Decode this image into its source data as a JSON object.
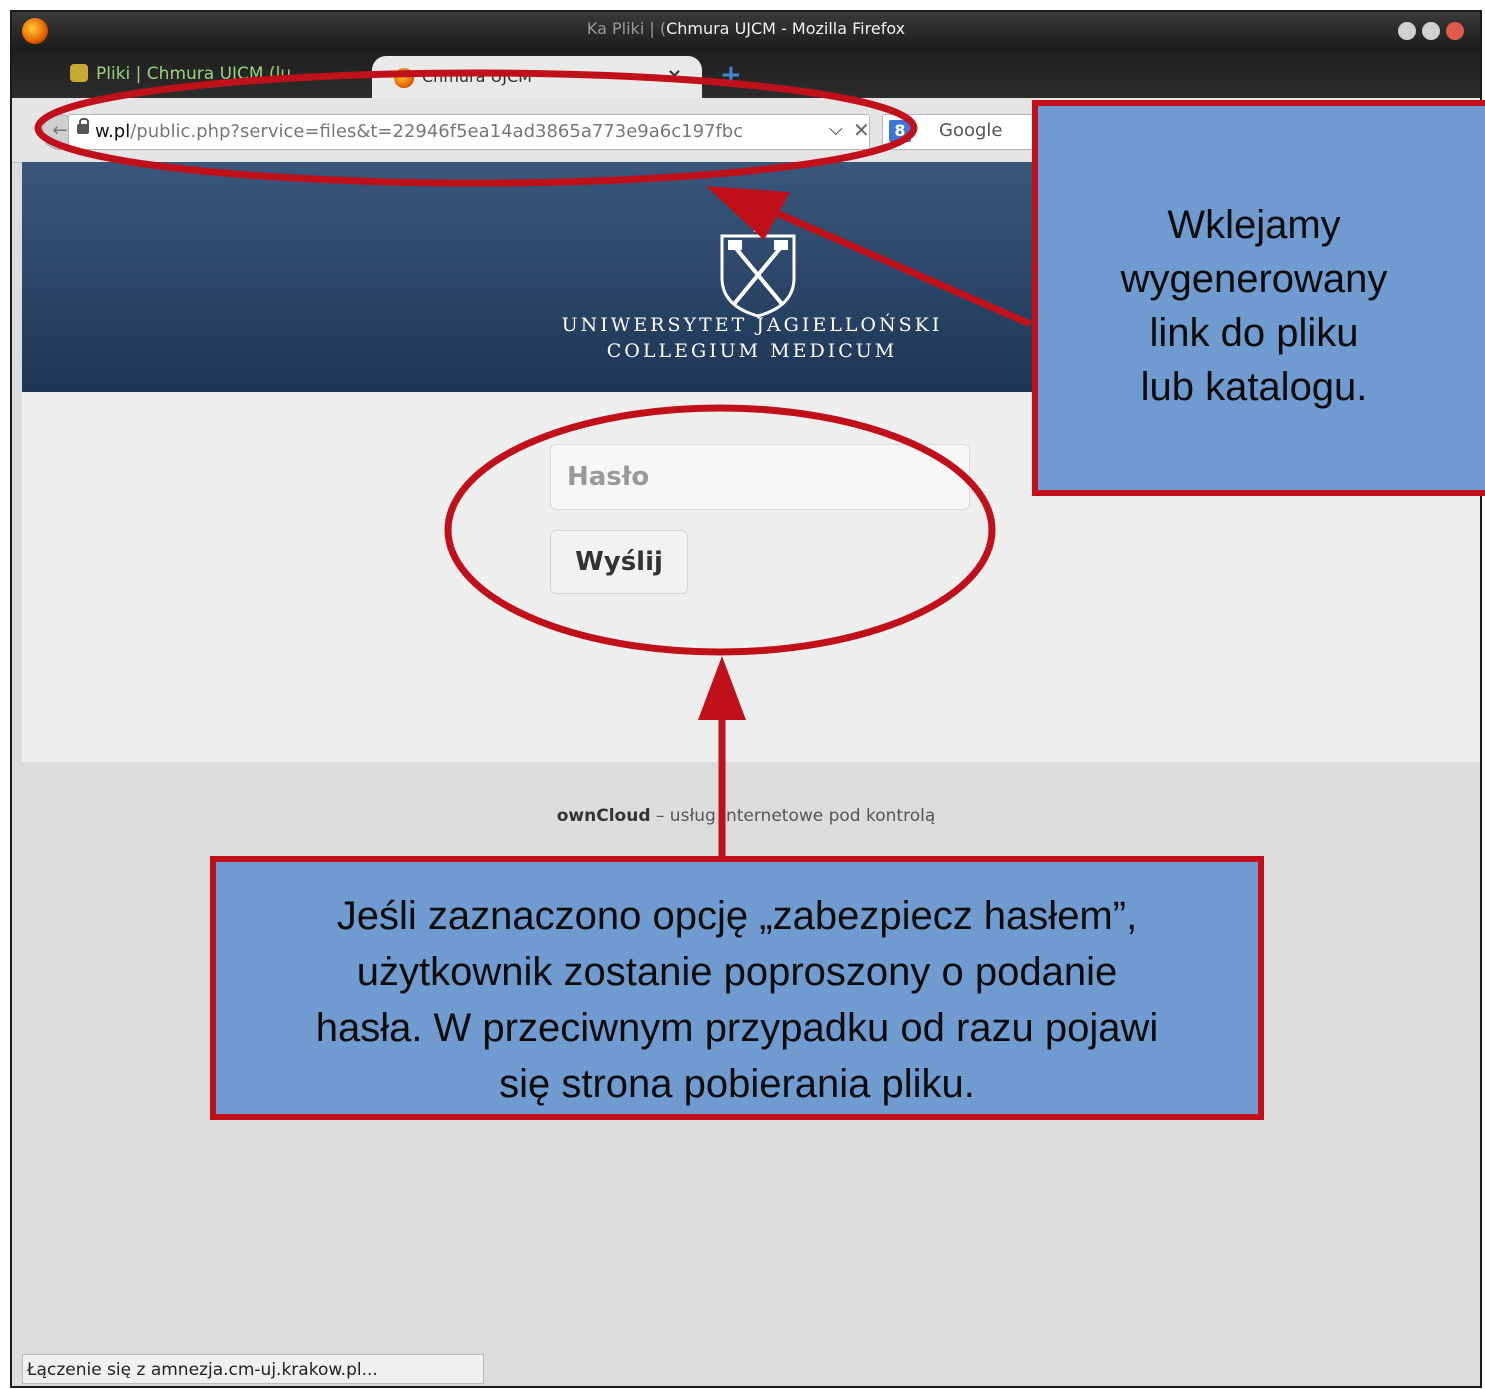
{
  "window": {
    "title_dim": "Ka Pliki | (",
    "title": "Chmura UJCM - Mozilla Firefox"
  },
  "tabs": [
    {
      "label": "Pliki | Chmura UJCM (lu..."
    },
    {
      "label": "Chmura UJCM",
      "close": "×"
    }
  ],
  "newtab_symbol": "+",
  "navbar": {
    "url_host": "w.pl",
    "url_path": "/public.php?service=files&t=22946f5ea14ad3865a773e9a6c197fbc",
    "search_engine_letter": "8",
    "search_placeholder": "Google"
  },
  "banner": {
    "line1": "UNIWERSYTET JAGIELLOŃSKI",
    "line2": "COLLEGIUM MEDICUM"
  },
  "form": {
    "password_placeholder": "Hasło",
    "submit_label": "Wyślij"
  },
  "footer": {
    "brand": "ownCloud",
    "text": " – usług internetowe pod kontrolą"
  },
  "status_bar": "Łączenie się z amnezja.cm-uj.krakow.pl...",
  "callouts": {
    "top": [
      "Wklejamy",
      "wygenerowany",
      "link do pliku",
      "lub katalogu."
    ],
    "bottom": [
      "Jeśli zaznaczono opcję „zabezpiecz hasłem”,",
      "użytkownik zostanie poproszony o podanie",
      "hasła. W przeciwnym przypadku od razu pojawi",
      "się strona pobierania pliku."
    ]
  },
  "colors": {
    "banner": "#2a4569",
    "callout_fill": "#6f9bd1",
    "annotation_red": "#c0111b"
  },
  "icons": [
    "firefox-icon",
    "crest-icon",
    "lock-icon",
    "google-icon"
  ]
}
